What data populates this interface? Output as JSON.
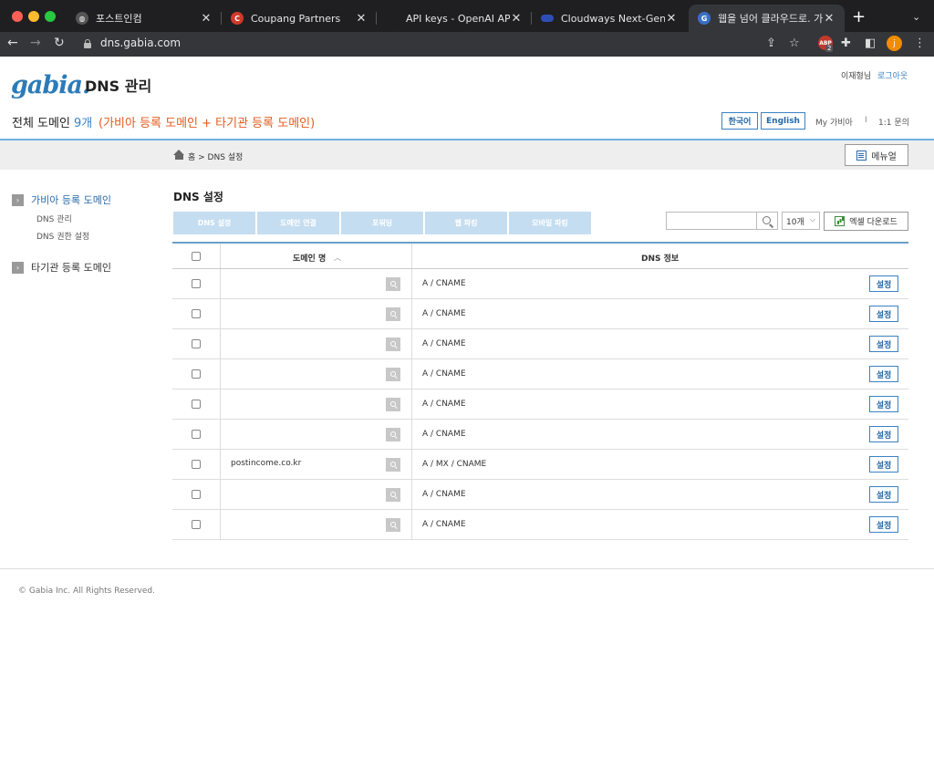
{
  "browser": {
    "tabs": [
      {
        "title": "포스트인컴",
        "fav_color": "#444444",
        "fav_text": ""
      },
      {
        "title": "Coupang Partners",
        "fav_color": "#d0392b",
        "fav_text": "C"
      },
      {
        "title": "API keys - OpenAI API",
        "fav_color": "#1f1f21",
        "fav_text": ""
      },
      {
        "title": "Cloudways Next-Generatio",
        "fav_color": "#2d4fb5",
        "fav_text": ""
      },
      {
        "title": "웹을 넘어 클라우드로. 가비아",
        "fav_color": "#3a6fc4",
        "fav_text": "G"
      }
    ],
    "url": "dns.gabia.com",
    "abp_label": "ABP",
    "abp_count": "2",
    "profile_initial": "j"
  },
  "header": {
    "logo": "gabia.",
    "title": "DNS 관리",
    "user_name": "이재형님",
    "logout": "로그아웃",
    "domain_label": "전체 도메인",
    "domain_count": "9개",
    "domain_desc": "(가비아 등록 도메인 + 타기관 등록 도메인)",
    "lang_korean": "한국어",
    "lang_english": "English",
    "my_gabia": "My 가비아",
    "separator": "I",
    "inquiry": "1:1 문의"
  },
  "breadcrumb": {
    "path": "홈 > DNS 설정",
    "manual": "메뉴얼"
  },
  "sidebar": {
    "groups": [
      {
        "label": "가비아 등록 도메인",
        "active": true,
        "items": [
          "DNS 관리",
          "DNS 권한 설정"
        ]
      },
      {
        "label": "타기관 등록 도메인",
        "active": false,
        "items": []
      }
    ]
  },
  "main": {
    "title": "DNS 설정",
    "actions": [
      "DNS 설정",
      "도메인 연결",
      "포워딩",
      "웹 파킹",
      "모바일 파킹"
    ],
    "search_value": "",
    "per_page": "10개",
    "excel": "엑셀 다운로드",
    "columns": {
      "domain": "도메인 명",
      "dns": "DNS 정보"
    },
    "set_label": "설정",
    "rows": [
      {
        "domain": "",
        "dns": "A / CNAME"
      },
      {
        "domain": "",
        "dns": "A / CNAME"
      },
      {
        "domain": "",
        "dns": "A / CNAME"
      },
      {
        "domain": "",
        "dns": "A / CNAME"
      },
      {
        "domain": "",
        "dns": "A / CNAME"
      },
      {
        "domain": "",
        "dns": "A / CNAME"
      },
      {
        "domain": "postincome.co.kr",
        "dns": "A / MX / CNAME"
      },
      {
        "domain": "",
        "dns": "A / CNAME"
      },
      {
        "domain": "",
        "dns": "A / CNAME"
      }
    ]
  },
  "footer": {
    "copyright": "© Gabia Inc. All Rights Reserved."
  },
  "colors": {
    "accent": "#3a82c4",
    "orange": "#e25b1e",
    "action_button": "#c5ddf0"
  }
}
